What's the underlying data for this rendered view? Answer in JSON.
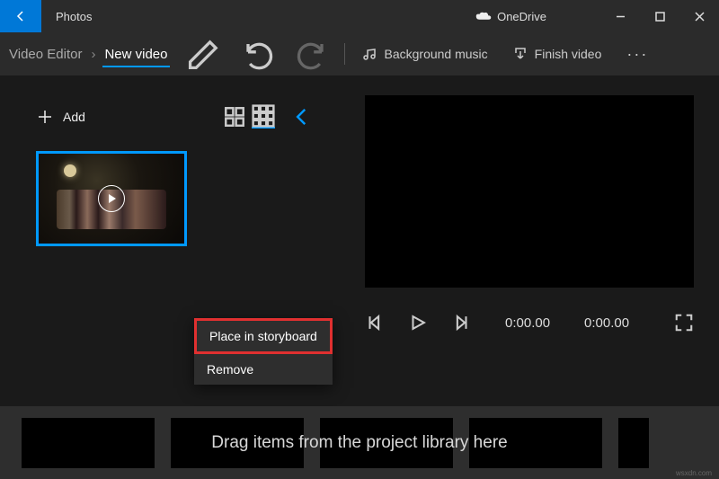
{
  "titlebar": {
    "app_name": "Photos",
    "onedrive_label": "OneDrive"
  },
  "toolbar": {
    "breadcrumb_root": "Video Editor",
    "breadcrumb_current": "New video",
    "bg_music_label": "Background music",
    "finish_label": "Finish video"
  },
  "library": {
    "add_label": "Add"
  },
  "context": {
    "place_label": "Place in storyboard",
    "remove_label": "Remove"
  },
  "player": {
    "time_current": "0:00.00",
    "time_total": "0:00.00"
  },
  "storyboard": {
    "hint": "Drag items from the project library here"
  },
  "watermark": "wsxdn.com"
}
